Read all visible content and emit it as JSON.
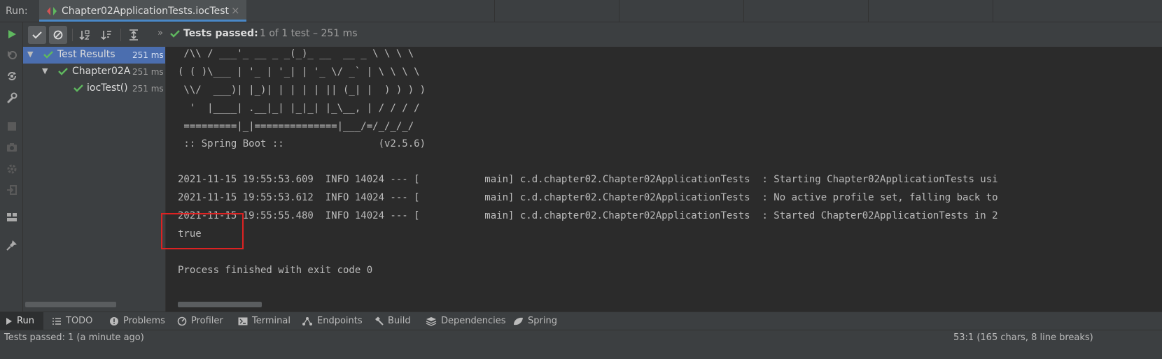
{
  "run_bar": {
    "label": "Run:",
    "tab_title": "Chapter02ApplicationTests.iocTest",
    "close_glyph": "×"
  },
  "left_toolbar": {
    "icons": [
      "rerun-icon",
      "rerun-failed-icon",
      "toggle-auto-test-icon",
      "wrench-icon",
      "stop-icon",
      "camera-icon",
      "gear-icon",
      "exit-icon",
      "layout-icon",
      "pin-icon"
    ]
  },
  "test_toolbar": {
    "icons": [
      "show-passed-icon",
      "show-ignored-icon",
      "sort-alpha-icon",
      "sort-duration-icon",
      "expand-all-icon"
    ],
    "chevron": "»",
    "status_bold": "Tests passed:",
    "status_rest": "1 of 1 test – 251 ms"
  },
  "tree": {
    "rows": [
      {
        "label": "Test Results",
        "time": "251 ms",
        "selected": true
      },
      {
        "label": "Chapter02A",
        "time": "251 ms",
        "selected": false
      },
      {
        "label": "iocTest()",
        "time": "251 ms",
        "selected": false
      }
    ]
  },
  "console": {
    "lines": [
      " /\\\\ / ___'_ __ _ _(_)_ __  __ _ \\ \\ \\ \\",
      "( ( )\\___ | '_ | '_| | '_ \\/ _` | \\ \\ \\ \\",
      " \\\\/  ___)| |_)| | | | | || (_| |  ) ) ) )",
      "  '  |____| .__|_| |_|_| |_\\__, | / / / /",
      " =========|_|==============|___/=/_/_/_/",
      " :: Spring Boot ::                (v2.5.6)",
      "",
      "2021-11-15 19:55:53.609  INFO 14024 --- [           main] c.d.chapter02.Chapter02ApplicationTests  : Starting Chapter02ApplicationTests usi",
      "2021-11-15 19:55:53.612  INFO 14024 --- [           main] c.d.chapter02.Chapter02ApplicationTests  : No active profile set, falling back to",
      "2021-11-15 19:55:55.480  INFO 14024 --- [           main] c.d.chapter02.Chapter02ApplicationTests  : Started Chapter02ApplicationTests in 2",
      "true",
      "",
      "Process finished with exit code 0"
    ]
  },
  "bottom_tabs": [
    {
      "label": "Run",
      "icon": "play-icon",
      "active": true
    },
    {
      "label": "TODO",
      "icon": "list-icon",
      "active": false
    },
    {
      "label": "Problems",
      "icon": "problems-icon",
      "active": false
    },
    {
      "label": "Profiler",
      "icon": "profiler-icon",
      "active": false
    },
    {
      "label": "Terminal",
      "icon": "terminal-icon",
      "active": false
    },
    {
      "label": "Endpoints",
      "icon": "endpoints-icon",
      "active": false
    },
    {
      "label": "Build",
      "icon": "hammer-icon",
      "active": false
    },
    {
      "label": "Dependencies",
      "icon": "dependencies-icon",
      "active": false
    },
    {
      "label": "Spring",
      "icon": "spring-leaf-icon",
      "active": false
    }
  ],
  "status_bar": {
    "left": "Tests passed: 1 (a minute ago)",
    "right": "53:1 (165 chars, 8 line breaks)"
  },
  "colors": {
    "pass_green": "#5fb85f",
    "selection_blue": "#4b6eaf",
    "highlight_red": "#dd2222"
  }
}
